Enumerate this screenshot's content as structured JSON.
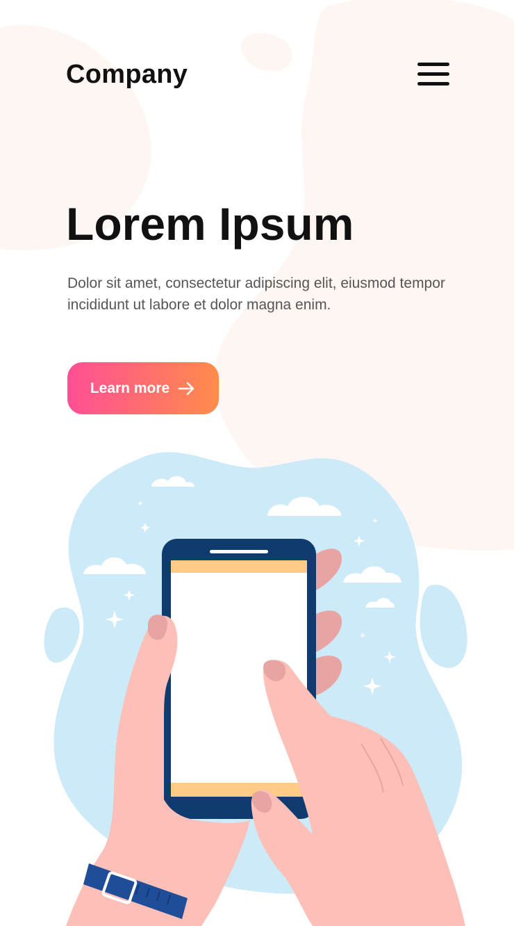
{
  "header": {
    "brand": "Company",
    "menu_icon": "hamburger-menu-icon"
  },
  "hero": {
    "title": "Lorem Ipsum",
    "description": "Dolor sit amet, consectetur adipiscing elit, eiusmod tempor incididunt ut labore et dolor magna enim.",
    "cta_label": "Learn more",
    "cta_icon": "arrow-right-icon"
  },
  "colors": {
    "text_primary": "#111111",
    "text_secondary": "#555555",
    "cta_gradient_start": "#ff4f95",
    "cta_gradient_end": "#ff8c4a",
    "background_blob": "#fdf6f3",
    "sky_blob": "#cdeaf8",
    "phone_body": "#0f3b6e",
    "phone_bar": "#fdcb86",
    "skin": "#fcc0b8"
  },
  "illustration": {
    "subject": "hands-holding-smartphone-illustration"
  }
}
